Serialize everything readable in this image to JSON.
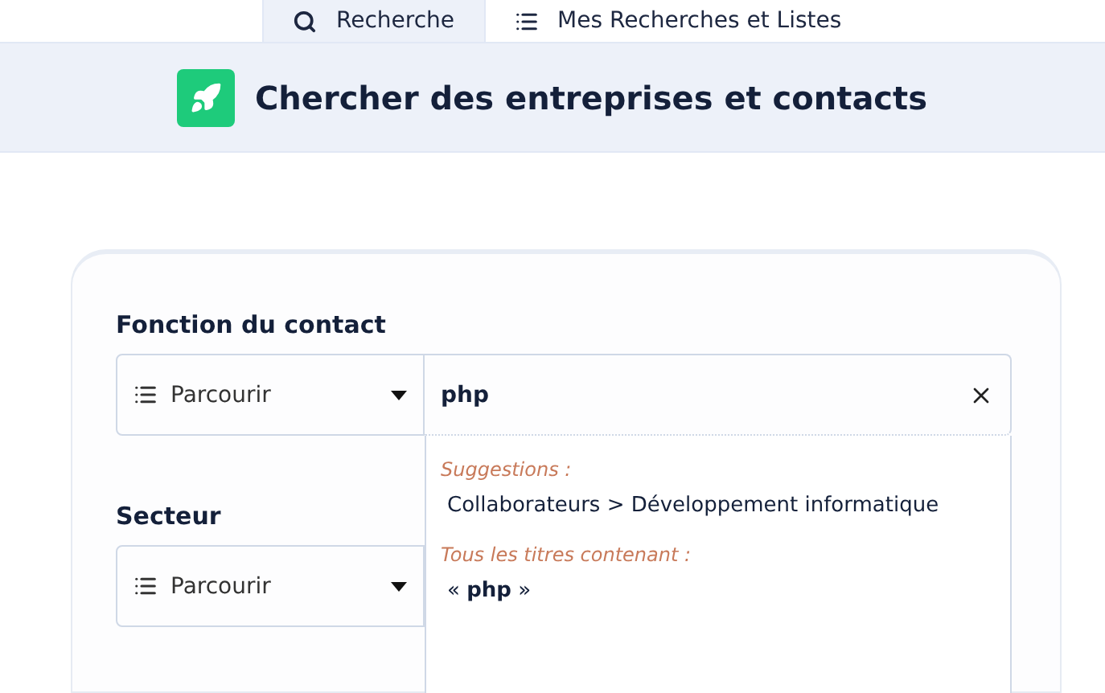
{
  "tabs": [
    {
      "label": "Recherche",
      "kind": "search",
      "selected": true
    },
    {
      "label": "Mes Recherches et Listes",
      "kind": "list",
      "selected": false
    }
  ],
  "header": {
    "title": "Chercher des entreprises et contacts"
  },
  "fields": [
    {
      "label": "Fonction du contact",
      "browse": "Parcourir",
      "value": "php",
      "dropdown": {
        "sections": [
          {
            "heading": "Suggestions :",
            "items": [
              "Collaborateurs > Développement informatique"
            ]
          },
          {
            "heading": "Tous les titres contenant :",
            "items": [
              "« **php** »"
            ]
          }
        ]
      }
    },
    {
      "label": "Secteur",
      "browse": "Parcourir"
    }
  ]
}
